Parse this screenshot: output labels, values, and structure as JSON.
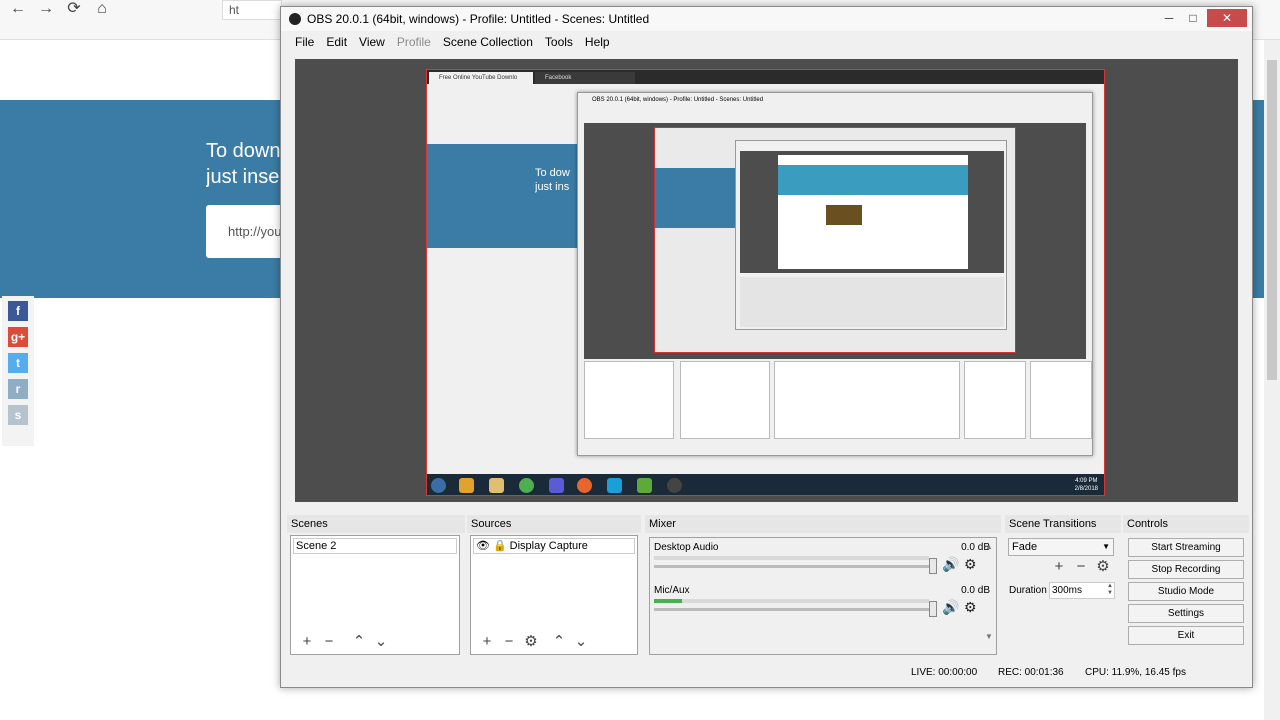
{
  "background_browser": {
    "nav": {
      "back": "←",
      "forward": "→",
      "reload": "⟳",
      "home": "⌂"
    },
    "url_text": "ht",
    "hero_text": "To down\njust inse",
    "input_text": "http://you",
    "social": [
      "f",
      "g+",
      "t",
      "r",
      "s"
    ]
  },
  "obs": {
    "title": "OBS 20.0.1 (64bit, windows) - Profile: Untitled - Scenes: Untitled",
    "menu": [
      {
        "label": "File",
        "enabled": true
      },
      {
        "label": "Edit",
        "enabled": true
      },
      {
        "label": "View",
        "enabled": true
      },
      {
        "label": "Profile",
        "enabled": false
      },
      {
        "label": "Scene Collection",
        "enabled": true
      },
      {
        "label": "Tools",
        "enabled": true
      },
      {
        "label": "Help",
        "enabled": true
      }
    ],
    "preview": {
      "tabs": [
        "Free Online YouTube Downlo",
        "Facebook"
      ],
      "hero_text": "To dow\njust ins",
      "clock": "4:09 PM\n2/8/2018",
      "nested_title": "OBS 20.0.1 (64bit, windows) - Profile: Untitled - Scenes: Untitled"
    },
    "docks": {
      "scenes": {
        "title": "Scenes",
        "items": [
          "Scene 2"
        ]
      },
      "sources": {
        "title": "Sources",
        "items": [
          "Display Capture"
        ]
      },
      "mixer": {
        "title": "Mixer",
        "tracks": [
          {
            "name": "Desktop Audio",
            "db": "0.0 dB",
            "level": 0
          },
          {
            "name": "Mic/Aux",
            "db": "0.0 dB",
            "level": 0.1
          }
        ]
      },
      "transitions": {
        "title": "Scene Transitions",
        "selected": "Fade",
        "duration_label": "Duration",
        "duration_value": "300ms"
      },
      "controls": {
        "title": "Controls",
        "buttons": [
          "Start Streaming",
          "Stop Recording",
          "Studio Mode",
          "Settings",
          "Exit"
        ]
      }
    },
    "status": {
      "live": "LIVE: 00:00:00",
      "rec": "REC: 00:01:36",
      "cpu": "CPU: 11.9%, 16.45 fps"
    },
    "colors": {
      "preview_bg": "#4d4d4d",
      "accent_blue": "#3a7ca5",
      "border_red": "#dd3333"
    }
  }
}
